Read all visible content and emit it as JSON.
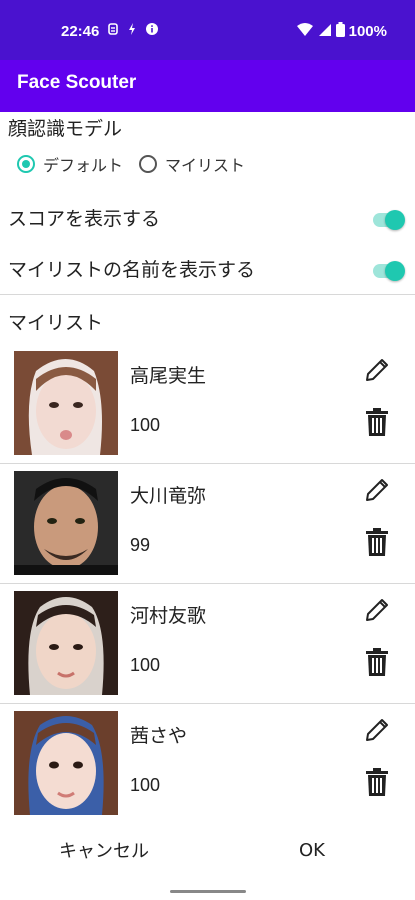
{
  "status_bar": {
    "time": "22:46",
    "battery": "100%"
  },
  "app_bar": {
    "title": "Face Scouter"
  },
  "model_section": {
    "title": "顔認識モデル",
    "options": [
      {
        "label": "デフォルト",
        "selected": true
      },
      {
        "label": "マイリスト",
        "selected": false
      }
    ]
  },
  "settings": {
    "show_score": {
      "label": "スコアを表示する",
      "on": true
    },
    "show_mylist_name": {
      "label": "マイリストの名前を表示する",
      "on": true
    }
  },
  "mylist": {
    "title": "マイリスト",
    "items": [
      {
        "name": "高尾実生",
        "score": "100"
      },
      {
        "name": "大川竜弥",
        "score": "99"
      },
      {
        "name": "河村友歌",
        "score": "100"
      },
      {
        "name": "茜さや",
        "score": "100"
      }
    ]
  },
  "footer": {
    "cancel_label": "キャンセル",
    "ok_label": "OK"
  },
  "colors": {
    "status_bar": "#4a12cf",
    "app_bar": "#6200ee",
    "accent": "#1fc8b0"
  },
  "icons": [
    "wifi-icon",
    "signal-icon",
    "battery-icon",
    "edit-icon",
    "delete-icon"
  ]
}
